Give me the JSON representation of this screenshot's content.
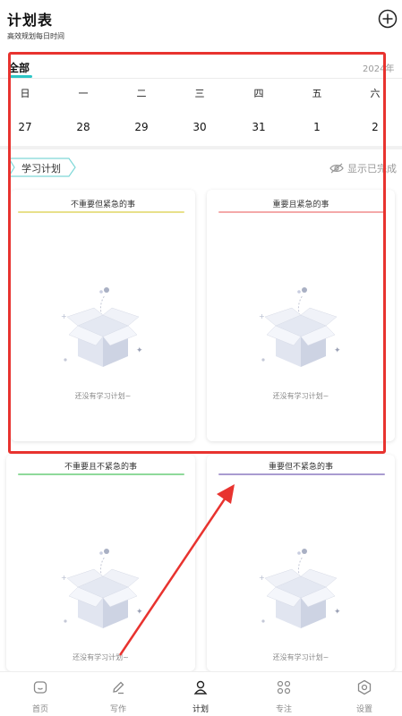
{
  "header": {
    "title": "计划表",
    "subtitle": "高效规划每日时间",
    "add_icon": "plus-circle-icon"
  },
  "filter": {
    "selected": "全部",
    "year": "2024年"
  },
  "calendar": {
    "weekdays": [
      "日",
      "一",
      "二",
      "三",
      "四",
      "五",
      "六"
    ],
    "dates": [
      "27",
      "28",
      "29",
      "30",
      "31",
      "1",
      "2"
    ]
  },
  "category": {
    "tag": "学习计划",
    "show_done": "显示已完成",
    "show_done_icon": "eye-off-icon"
  },
  "quadrants": [
    {
      "title": "不重要但紧急的事",
      "color": "#e8e08a",
      "empty": "还没有学习计划~"
    },
    {
      "title": "重要且紧急的事",
      "color": "#f4a9a9",
      "empty": "还没有学习计划~"
    },
    {
      "title": "不重要且不紧急的事",
      "color": "#8fd99a",
      "empty": "还没有学习计划~"
    },
    {
      "title": "重要但不紧急的事",
      "color": "#a99bd0",
      "empty": "还没有学习计划~"
    }
  ],
  "nav": [
    {
      "label": "首页",
      "icon": "home-icon"
    },
    {
      "label": "写作",
      "icon": "pen-icon"
    },
    {
      "label": "计划",
      "icon": "plan-icon",
      "active": true
    },
    {
      "label": "专注",
      "icon": "grid-icon"
    },
    {
      "label": "设置",
      "icon": "settings-icon"
    }
  ],
  "colors": {
    "accent": "#2cc6c6",
    "annotation": "#e8332f"
  }
}
